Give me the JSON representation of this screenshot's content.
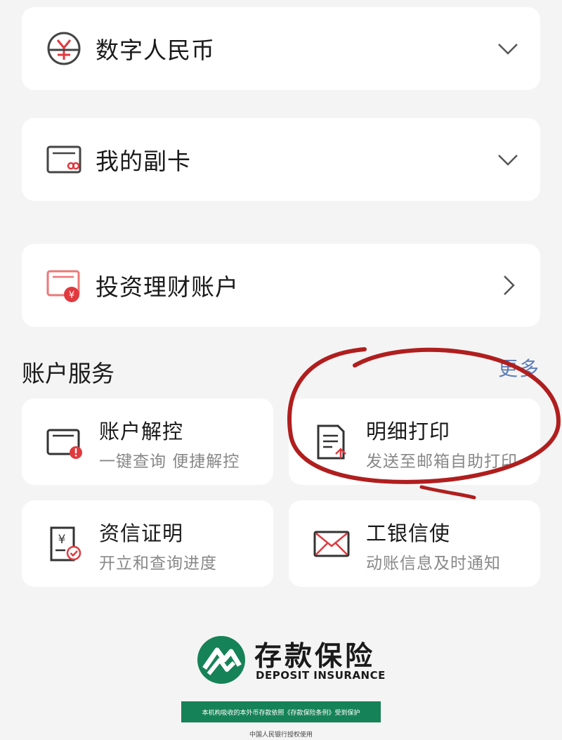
{
  "accounts": [
    {
      "label": "数字人民币",
      "icon": "digital-rmb-icon",
      "chevron": "chevron-down-icon"
    },
    {
      "label": "我的副卡",
      "icon": "sub-card-icon",
      "chevron": "chevron-down-icon"
    },
    {
      "label": "投资理财账户",
      "icon": "investment-account-icon",
      "chevron": "chevron-right-icon"
    }
  ],
  "services": {
    "title": "账户服务",
    "more": "更多",
    "items": [
      {
        "title": "账户解控",
        "desc": "一键查询 便捷解控",
        "icon": "card-warning-icon"
      },
      {
        "title": "明细打印",
        "desc": "发送至邮箱自助打印",
        "icon": "document-upload-icon"
      },
      {
        "title": "资信证明",
        "desc": "开立和查询进度",
        "icon": "credit-certificate-icon"
      },
      {
        "title": "工银信使",
        "desc": "动账信息及时通知",
        "icon": "envelope-icon"
      }
    ]
  },
  "deposit_insurance": {
    "title": "存款保险",
    "subtitle": "DEPOSIT INSURANCE",
    "notice": "本机构吸收的本外币存款依照《存款保险条例》受到保护",
    "footer": "中国人民银行授权使用"
  },
  "colors": {
    "accent_red": "#e0393e",
    "link_blue": "#5b7cb8",
    "insurance_green": "#168257",
    "annotation_red": "#b01e1e"
  }
}
